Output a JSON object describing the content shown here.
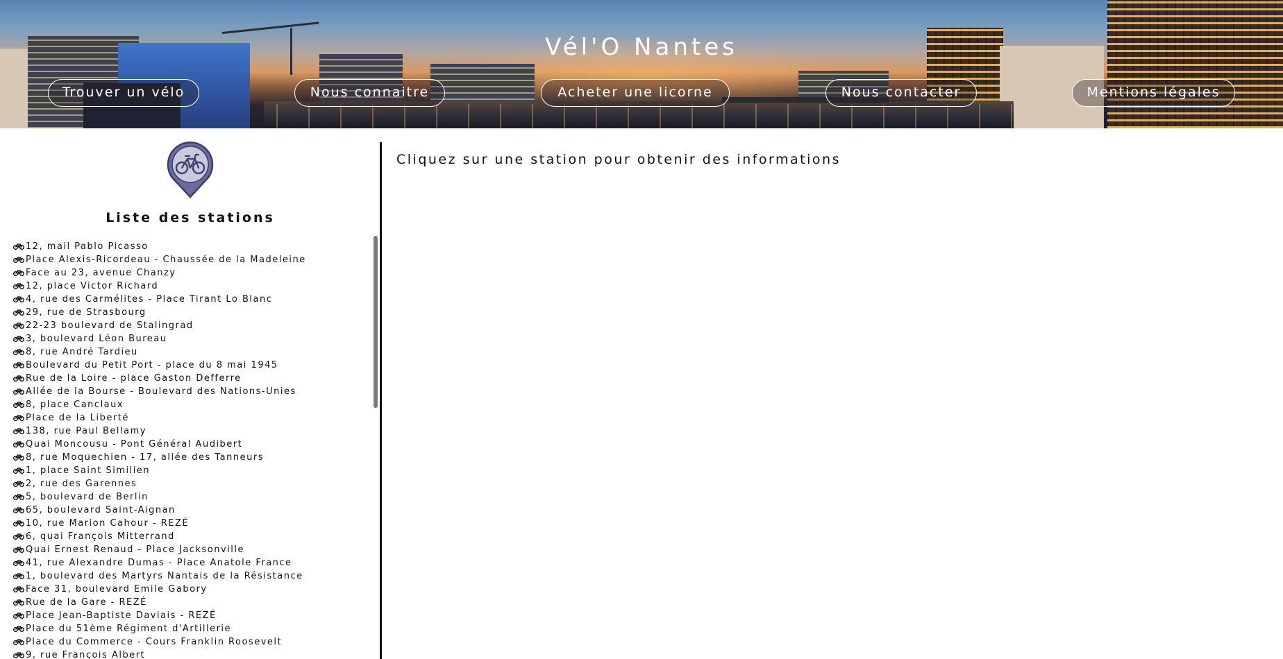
{
  "header": {
    "site_title": "Vél'O Nantes",
    "nav": [
      {
        "label": "Trouver un vélo"
      },
      {
        "label": "Nous connaitre"
      },
      {
        "label": "Acheter une licorne"
      },
      {
        "label": "Nous contacter"
      },
      {
        "label": "Mentions légales"
      }
    ]
  },
  "sidebar": {
    "marker_icon": "bike-map-marker-icon",
    "heading": "Liste des stations",
    "item_icon": "bicycle-icon",
    "stations": [
      "12, mail Pablo Picasso",
      "Place Alexis-Ricordeau - Chaussée de la Madeleine",
      "Face au 23, avenue Chanzy",
      "12, place Victor Richard",
      "4, rue des Carmélites - Place Tirant Lo Blanc",
      "29, rue de Strasbourg",
      "22-23 boulevard de Stalingrad",
      "3, boulevard Léon Bureau",
      "8, rue André Tardieu",
      "Boulevard du Petit Port - place du 8 mai 1945",
      "Rue de la Loire - place Gaston Defferre",
      "Allée de la Bourse - Boulevard des Nations-Unies",
      "8, place Canclaux",
      "Place de la Liberté",
      "138, rue Paul Bellamy",
      "Quai Moncousu - Pont Général Audibert",
      "8, rue Moquechien - 17, allée des Tanneurs",
      "1, place Saint Similien",
      "2, rue des Garennes",
      "5, boulevard de Berlin",
      "65, boulevard Saint-Aignan",
      "10, rue Marion Cahour - REZÉ",
      "6, quai François Mitterrand",
      "Quai Ernest Renaud - Place Jacksonville",
      "41, rue Alexandre Dumas - Place Anatole France",
      "1, boulevard des Martyrs Nantais de la Résistance",
      "Face 31, boulevard Emile Gabory",
      "Rue de la Gare - REZÉ",
      "Place Jean-Baptiste Daviais - REZÉ",
      "Place du 51ème Régiment d'Artillerie",
      "Place du Commerce - Cours Franklin Roosevelt",
      "9, rue François Albert"
    ]
  },
  "main": {
    "info_text": "Cliquez sur une station pour obtenir des informations"
  },
  "colors": {
    "marker_fill": "#6b6b9e",
    "marker_stroke": "#3d3d6b",
    "divider": "#111111",
    "text": "#111111"
  }
}
